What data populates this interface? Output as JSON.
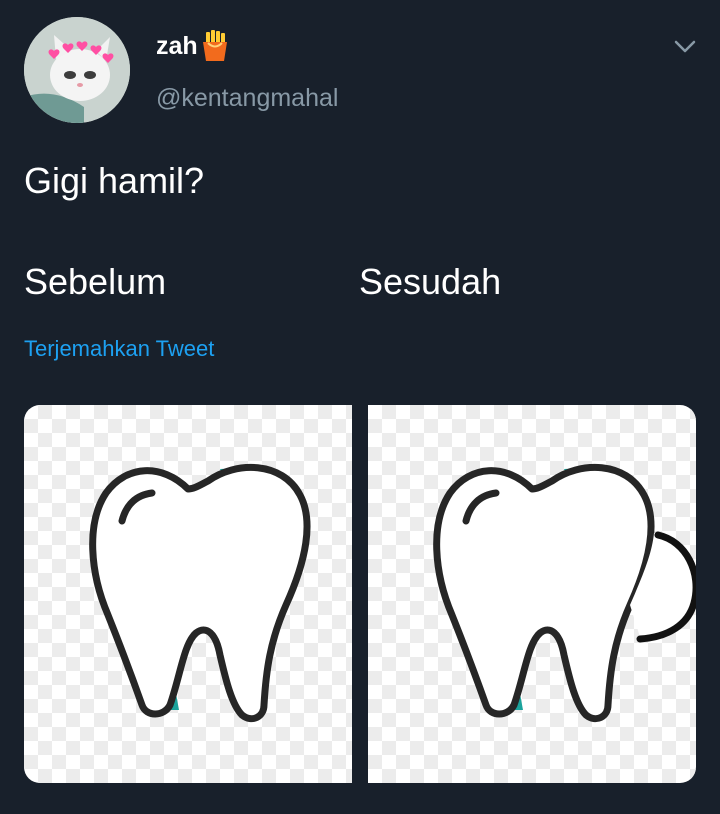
{
  "user": {
    "display_name": "zah",
    "handle": "@kentangmahal",
    "avatar_icon": "cat-with-hearts-avatar",
    "badge_icon": "fries-emoji-icon"
  },
  "tweet": {
    "question": "Gigi hamil?",
    "label_before": "Sebelum",
    "label_after": "Sesudah"
  },
  "translate_link": "Terjemahkan Tweet",
  "colors": {
    "background": "#18202b",
    "link": "#1da1f2",
    "secondary_text": "#8899a6",
    "tooth_accent": "#1ba39c"
  },
  "media": {
    "images": [
      {
        "icon": "tooth-icon",
        "variant": "normal"
      },
      {
        "icon": "tooth-pregnant-icon",
        "variant": "bulging"
      }
    ]
  }
}
